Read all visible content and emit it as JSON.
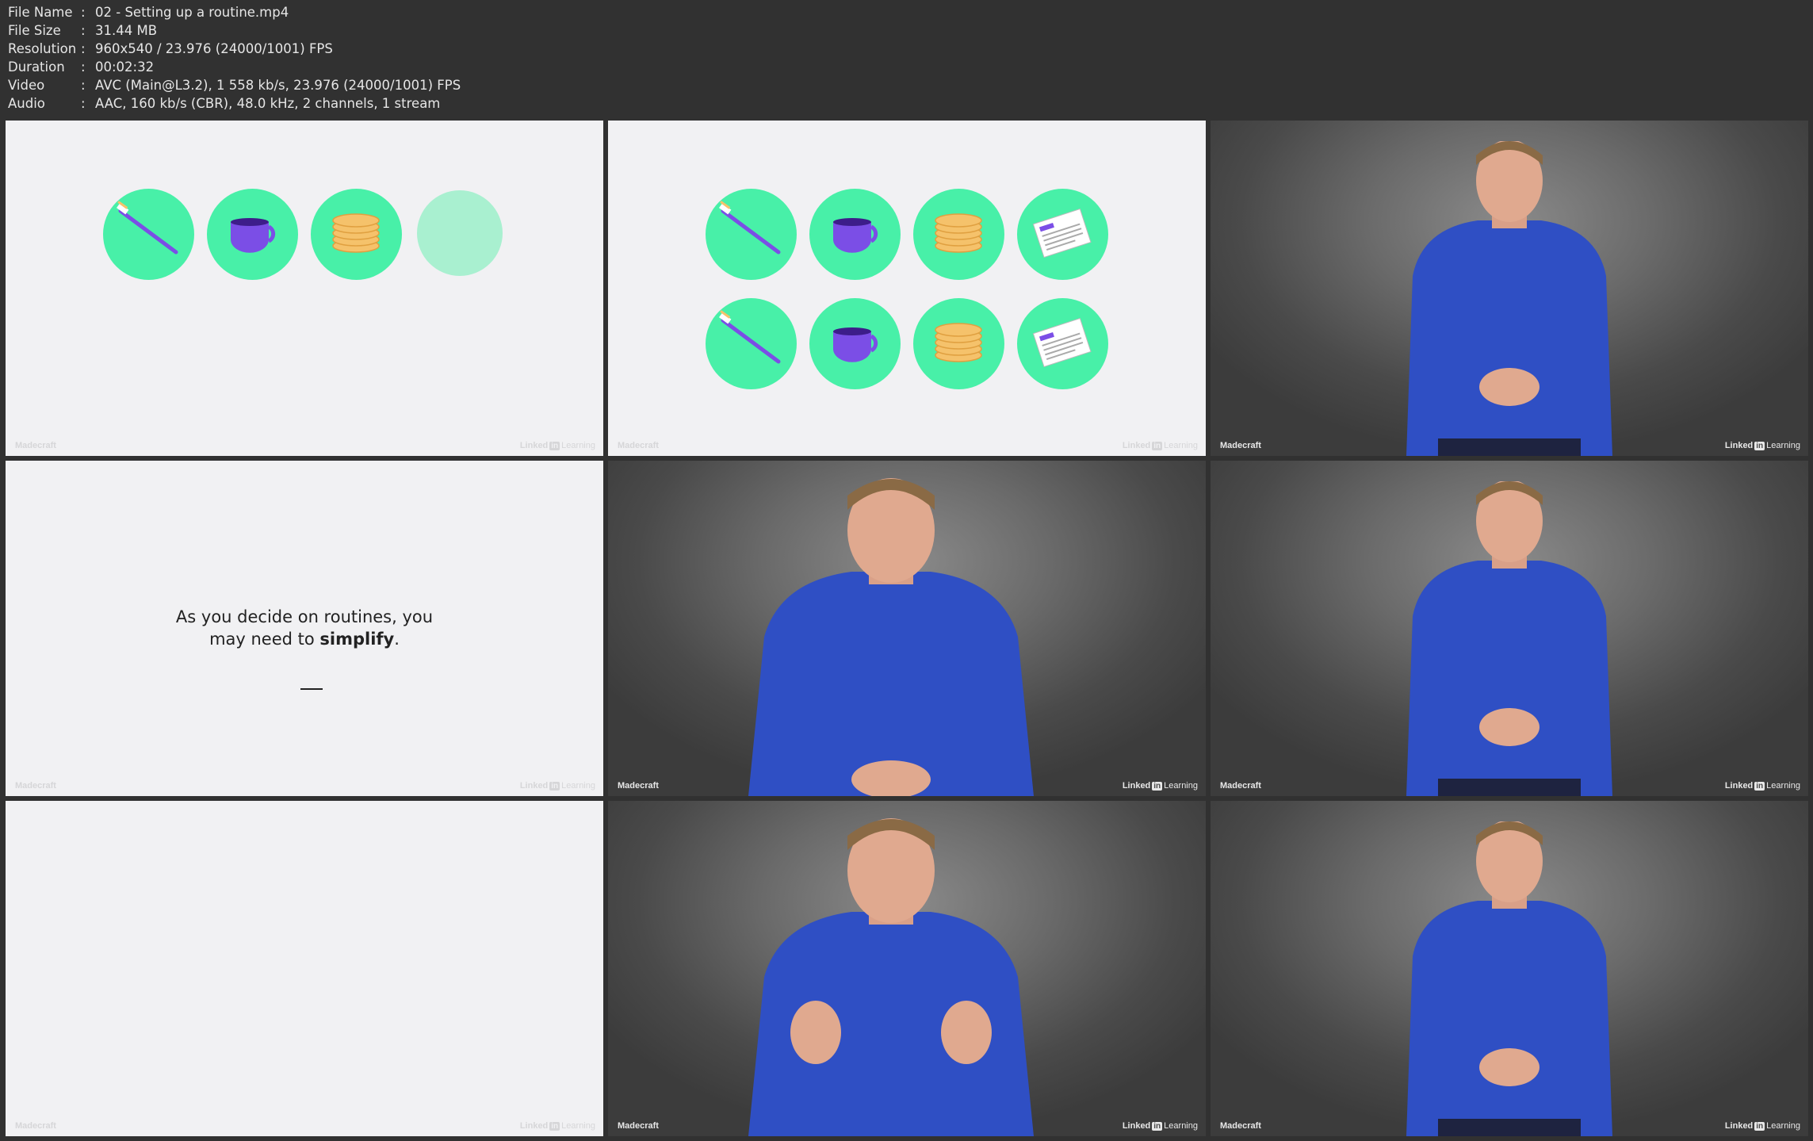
{
  "info": {
    "rows": [
      {
        "key": "File Name",
        "value": "02 - Setting up a routine.mp4"
      },
      {
        "key": "File Size",
        "value": "31.44 MB"
      },
      {
        "key": "Resolution",
        "value": "960x540 / 23.976 (24000/1001) FPS"
      },
      {
        "key": "Duration",
        "value": "00:02:32"
      },
      {
        "key": "Video",
        "value": "AVC (Main@L3.2), 1 558 kb/s, 23.976 (24000/1001) FPS"
      },
      {
        "key": "Audio",
        "value": "AAC, 160 kb/s (CBR), 48.0 kHz, 2 channels, 1 stream"
      }
    ]
  },
  "watermark": {
    "left": "Madecraft",
    "right_a": "Linked",
    "right_in": "in",
    "right_b": "Learning"
  },
  "slide": {
    "line1": "As you decide on routines, you",
    "line2_a": "may need to ",
    "line2_bold": "simplify",
    "line2_b": "."
  },
  "icons": [
    "toothbrush-icon",
    "coffee-cup-icon",
    "pancakes-icon",
    "newspaper-icon"
  ],
  "colors": {
    "accent_green": "#48f0a8",
    "faded_green": "#a9f0d0",
    "cup_purple": "#7b4ee6",
    "pancake": "#f5c26b",
    "shirt_blue": "#2f4fc4",
    "background": "#313131",
    "slide_bg": "#f1f1f3"
  }
}
